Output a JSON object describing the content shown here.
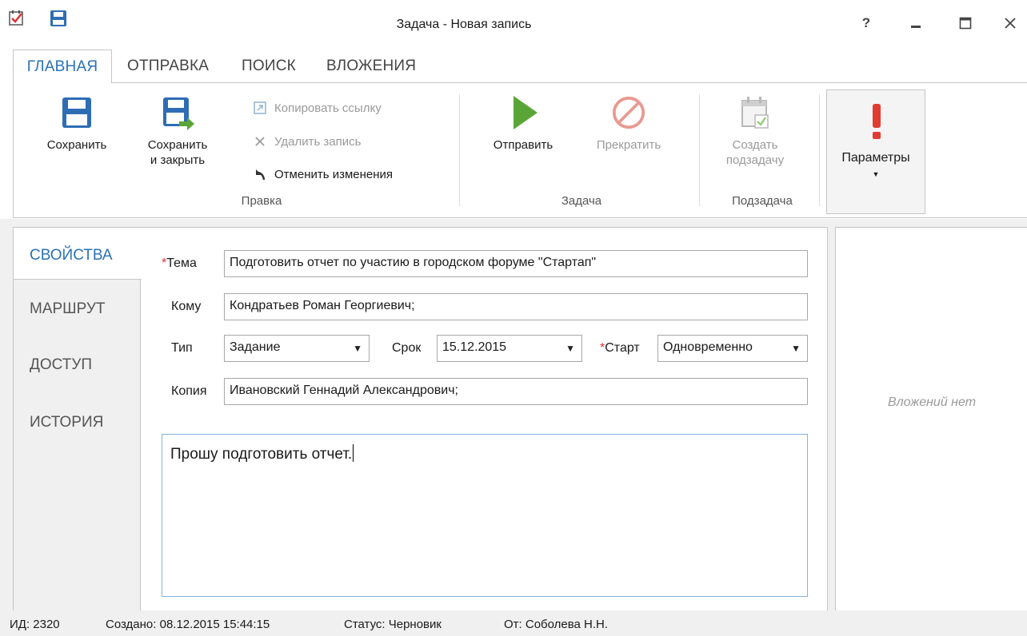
{
  "window": {
    "title": "Задача - Новая запись",
    "help": "?",
    "minimize": "‒",
    "maximize": "☐",
    "close": "✕"
  },
  "ribbon_tabs": [
    {
      "label": "ГЛАВНАЯ",
      "active": true
    },
    {
      "label": "ОТПРАВКА",
      "active": false
    },
    {
      "label": "ПОИСК",
      "active": false
    },
    {
      "label": "ВЛОЖЕНИЯ",
      "active": false
    }
  ],
  "ribbon": {
    "edit_group": {
      "label": "Правка",
      "save": "Сохранить",
      "save_close_line1": "Сохранить",
      "save_close_line2": "и закрыть",
      "copy_link": "Копировать ссылку",
      "delete_record": "Удалить запись",
      "undo_changes": "Отменить изменения"
    },
    "task_group": {
      "label": "Задача",
      "send": "Отправить",
      "stop": "Прекратить"
    },
    "subtask_group": {
      "label": "Подзадача",
      "create_line1": "Создать",
      "create_line2": "подзадачу"
    },
    "params": "Параметры"
  },
  "side_tabs": [
    {
      "label": "СВОЙСТВА",
      "active": true
    },
    {
      "label": "МАРШРУТ",
      "active": false
    },
    {
      "label": "ДОСТУП",
      "active": false
    },
    {
      "label": "ИСТОРИЯ",
      "active": false
    }
  ],
  "form": {
    "subject_label": "Тема",
    "subject_value": "Подготовить отчет по участию в городском форуме \"Стартап\"",
    "to_label": "Кому",
    "to_value": "Кондратьев Роман Георгиевич;",
    "type_label": "Тип",
    "type_value": "Задание",
    "due_label": "Срок",
    "due_value": "15.12.2015",
    "start_label": "Старт",
    "start_value": "Одновременно",
    "copy_label": "Копия",
    "copy_value": "Ивановский Геннадий Александрович;",
    "body": "Прошу подготовить отчет.",
    "required_mark": "*"
  },
  "attachments": {
    "empty_text": "Вложений нет"
  },
  "status_bar": {
    "id": "ИД: 2320",
    "created": "Создано: 08.12.2015 15:44:15",
    "status": "Статус: Черновик",
    "from": "От: Соболева Н.Н."
  },
  "colors": {
    "accent": "#2a72b5",
    "save_icon": "#2e6db4",
    "send_green": "#5aa537",
    "stop_red": "#e89a92",
    "params_red": "#e03c31",
    "required": "#d33333"
  }
}
